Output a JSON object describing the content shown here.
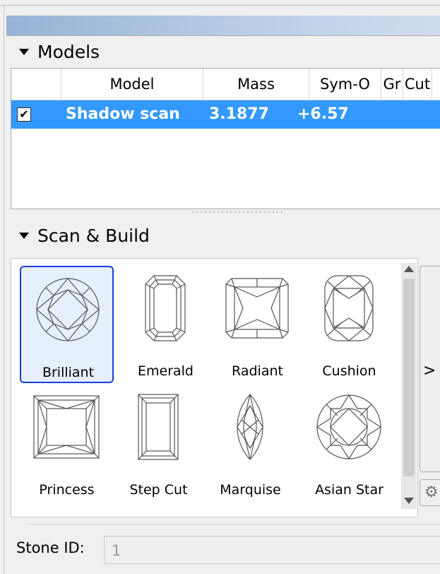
{
  "models_panel": {
    "title": "Models",
    "columns": [
      "Model",
      "Mass",
      "Sym-O",
      "Gr",
      "Cut"
    ],
    "rows": [
      {
        "checked": true,
        "model": "Shadow scan",
        "mass": "3.1877",
        "sym_o": "+6.57",
        "gr": "",
        "cut": ""
      }
    ]
  },
  "scan_build_panel": {
    "title": "Scan & Build",
    "shapes": [
      {
        "label": "Brilliant",
        "icon": "brilliant-cut-icon",
        "selected": true
      },
      {
        "label": "Emerald",
        "icon": "emerald-cut-icon",
        "selected": false
      },
      {
        "label": "Radiant",
        "icon": "radiant-cut-icon",
        "selected": false
      },
      {
        "label": "Cushion",
        "icon": "cushion-cut-icon",
        "selected": false
      },
      {
        "label": "Princess",
        "icon": "princess-cut-icon",
        "selected": false
      },
      {
        "label": "Step Cut",
        "icon": "step-cut-icon",
        "selected": false
      },
      {
        "label": "Marquise",
        "icon": "marquise-cut-icon",
        "selected": false
      },
      {
        "label": "Asian Star",
        "icon": "asian-star-cut-icon",
        "selected": false
      }
    ],
    "side_button_label": ">",
    "stone_id": {
      "label": "Stone ID:",
      "value": "1"
    }
  },
  "colors": {
    "selection": "#3399ff",
    "selected_border": "#1a3ed9"
  }
}
